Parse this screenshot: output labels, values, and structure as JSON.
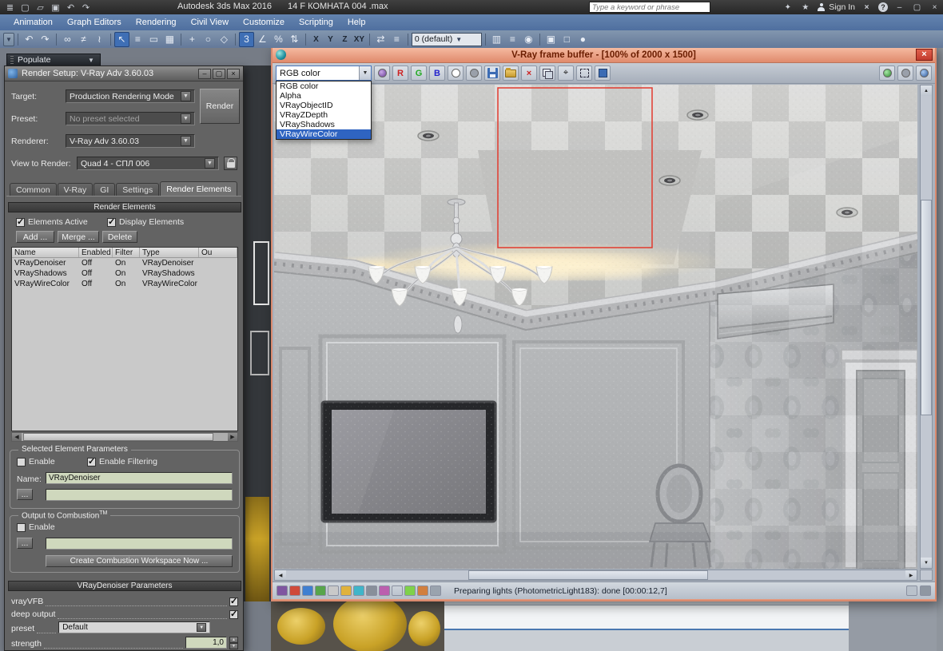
{
  "colors": {
    "selection_blue": "#2f64c1",
    "vfb_frame": "#e59a7f",
    "vfb_title_text": "#6b1d00",
    "menubar_blue": "#4f6f9f",
    "region_red": "#e23a2e",
    "close_red": "#c23b2e"
  },
  "app": {
    "name": "Autodesk 3ds Max 2016",
    "file": "14  F КОМНАТА 004 .max",
    "search_placeholder": "Type a keyword or phrase",
    "sign_in": "Sign In"
  },
  "menubar": {
    "items": [
      "Animation",
      "Graph Editors",
      "Rendering",
      "Civil View",
      "Customize",
      "Scripting",
      "Help"
    ]
  },
  "toolbar": {
    "snap_value": "3",
    "axis_buttons": [
      "X",
      "Y",
      "Z",
      "XY"
    ],
    "layer_dropdown": "0 (default)"
  },
  "populate": {
    "title": "Populate"
  },
  "render_setup": {
    "title": "Render Setup: V-Ray Adv 3.60.03",
    "target_label": "Target:",
    "target_value": "Production Rendering Mode",
    "preset_label": "Preset:",
    "preset_value": "No preset selected",
    "renderer_label": "Renderer:",
    "renderer_value": "V-Ray Adv 3.60.03",
    "view_label": "View to Render:",
    "view_value": "Quad 4 - СПЛ 006",
    "render_button": "Render",
    "tabs": [
      "Common",
      "V-Ray",
      "GI",
      "Settings",
      "Render Elements"
    ],
    "rollout_elements": "Render Elements",
    "rollout_denoiser": "VRayDenoiser Parameters",
    "elements_active_label": "Elements Active",
    "display_elements_label": "Display Elements",
    "add_button": "Add ...",
    "merge_button": "Merge ...",
    "delete_button": "Delete",
    "table": {
      "columns": [
        "Name",
        "Enabled",
        "Filter",
        "Type",
        "Ou"
      ],
      "rows": [
        {
          "name": "VRayDenoiser",
          "enabled": "Off",
          "filter": "On",
          "type": "VRayDenoiser"
        },
        {
          "name": "VRayShadows",
          "enabled": "Off",
          "filter": "On",
          "type": "VRayShadows"
        },
        {
          "name": "VRayWireColor",
          "enabled": "Off",
          "filter": "On",
          "type": "VRayWireColor"
        }
      ]
    },
    "selected_params": {
      "title": "Selected Element Parameters",
      "enable_label": "Enable",
      "enable_filtering_label": "Enable Filtering",
      "name_label": "Name:",
      "name_value": "VRayDenoiser",
      "browse_label": "..."
    },
    "combustion": {
      "title": "Output to Combustion",
      "tm": "TM",
      "enable_label": "Enable",
      "browse_label": "...",
      "create_button": "Create Combustion Workspace Now ..."
    },
    "denoiser": {
      "vrayvfb_label": "vrayVFB",
      "deep_output_label": "deep output",
      "preset_label": "preset",
      "preset_value": "Default",
      "strength_label": "strength",
      "strength_value": "1,0"
    }
  },
  "vfb": {
    "title": "V-Ray frame buffer - [100% of 2000 x 1500]",
    "channel_select_value": "RGB color",
    "channel_options": [
      "RGB color",
      "Alpha",
      "VRayObjectID",
      "VRayZDepth",
      "VRayShadows",
      "VRayWireColor"
    ],
    "highlighted_option": "VRayWireColor",
    "rgb_buttons": [
      "R",
      "G",
      "B"
    ],
    "status_text": "Preparing lights (PhotometricLight183): done [00:00:12,7]"
  }
}
